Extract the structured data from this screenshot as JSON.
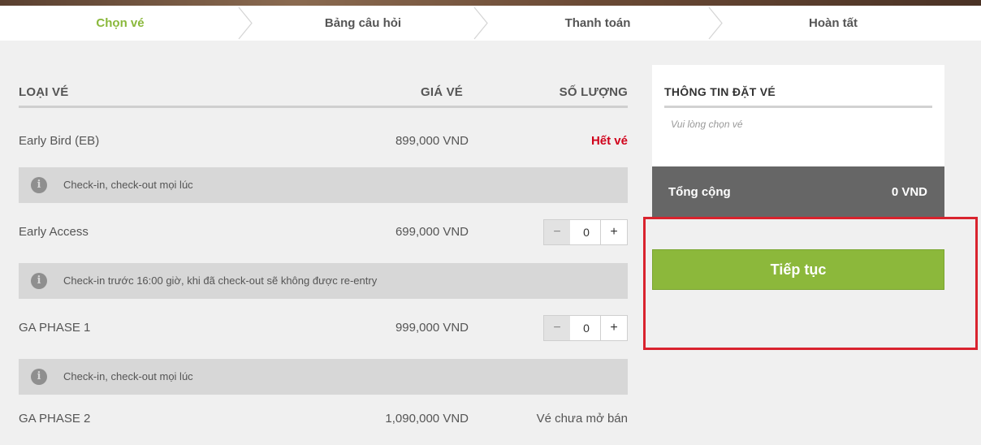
{
  "steps": [
    {
      "label": "Chọn vé",
      "active": true
    },
    {
      "label": "Bảng câu hỏi",
      "active": false
    },
    {
      "label": "Thanh toán",
      "active": false
    },
    {
      "label": "Hoàn tất",
      "active": false
    }
  ],
  "table": {
    "col_type": "LOẠI VÉ",
    "col_price": "GIÁ VÉ",
    "col_qty": "SỐ LƯỢNG"
  },
  "tickets": [
    {
      "name": "Early Bird (EB)",
      "price": "899,000 VND",
      "status": "Hết vé",
      "info": "Check-in, check-out mọi lúc"
    },
    {
      "name": "Early Access",
      "price": "699,000 VND",
      "qty": "0",
      "info": "Check-in trước 16:00 giờ, khi đã check-out sẽ không được re-entry"
    },
    {
      "name": "GA PHASE 1",
      "price": "999,000 VND",
      "qty": "0",
      "info": "Check-in, check-out mọi lúc"
    },
    {
      "name": "GA PHASE 2",
      "price": "1,090,000 VND",
      "status": "Vé chưa mở bán"
    }
  ],
  "stepper": {
    "minus": "−",
    "plus": "+"
  },
  "info_icon": "i",
  "summary": {
    "title": "THÔNG TIN ĐẶT VÉ",
    "empty": "Vui lòng chọn vé",
    "total_label": "Tổng cộng",
    "total_value": "0 VND"
  },
  "continue_label": "Tiếp tục",
  "colors": {
    "accent": "#8cb83b",
    "soldout": "#d0021b",
    "highlight_box": "#d9232e"
  }
}
